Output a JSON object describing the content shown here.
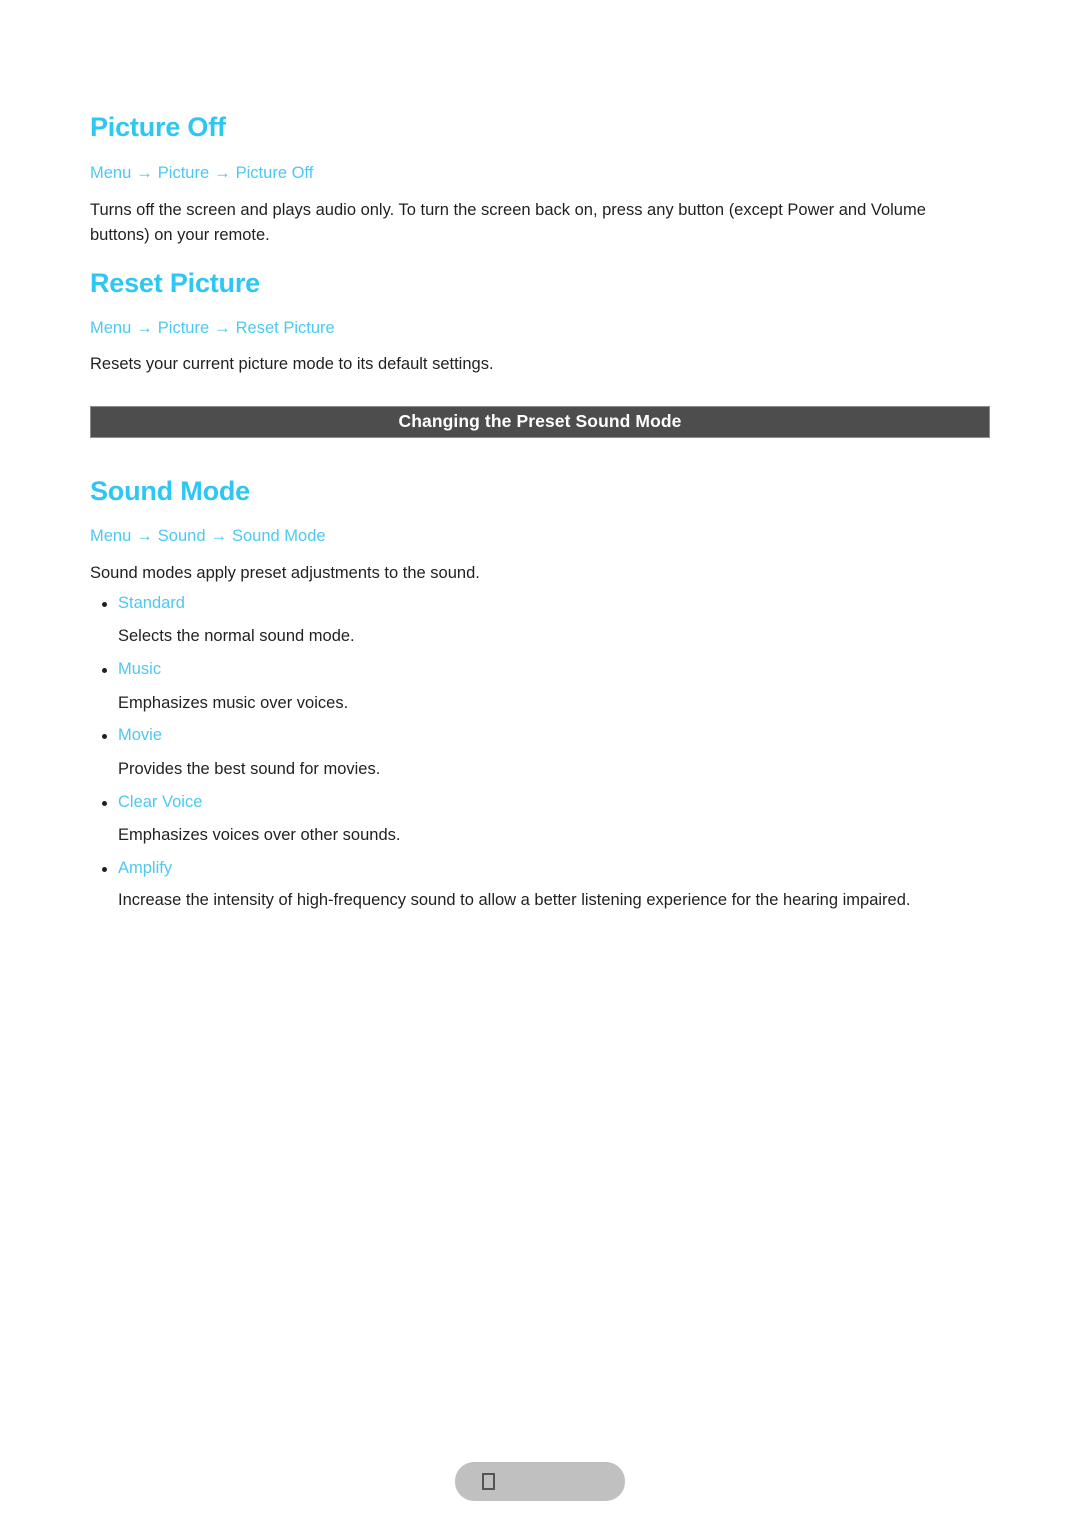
{
  "colors": {
    "accent_cyan": "#2ec7f3",
    "link_cyan": "#4cc9f0",
    "body_text": "#231f20",
    "banner_bg": "#4d4d4d",
    "banner_border": "#8c8c8c",
    "banner_text": "#ffffff",
    "footer_pill": "#c0c0c0",
    "page_bg": "#ffffff"
  },
  "sections": [
    {
      "title": "Picture Off",
      "breadcrumb": {
        "crumbs": [
          "Menu",
          "Picture",
          "Picture Off"
        ],
        "separator": "→"
      },
      "body": "Turns off the screen and plays audio only. To turn the screen back on, press any button (except Power and Volume buttons) on your remote."
    },
    {
      "title": "Reset Picture",
      "breadcrumb": {
        "crumbs": [
          "Menu",
          "Picture",
          "Reset Picture"
        ],
        "separator": "→"
      },
      "body": "Resets your current picture mode to its default settings."
    }
  ],
  "banner": {
    "text": "Changing the Preset Sound Mode"
  },
  "sound_mode": {
    "title": "Sound Mode",
    "breadcrumb": {
      "crumbs": [
        "Menu",
        "Sound",
        "Sound Mode"
      ],
      "separator": "→"
    },
    "body": "Sound modes apply preset adjustments to the sound.",
    "options": [
      {
        "label": "Standard",
        "description": "Selects the normal sound mode."
      },
      {
        "label": "Music",
        "description": "Emphasizes music over voices."
      },
      {
        "label": "Movie",
        "description": "Provides the best sound for movies."
      },
      {
        "label": "Clear Voice",
        "description": "Emphasizes voices over other sounds."
      },
      {
        "label": "Amplify",
        "description": "Increase the intensity of high-frequency sound to allow a better listening experience for the hearing impaired."
      }
    ]
  },
  "footer": {
    "glyph": "missing-character-box"
  }
}
